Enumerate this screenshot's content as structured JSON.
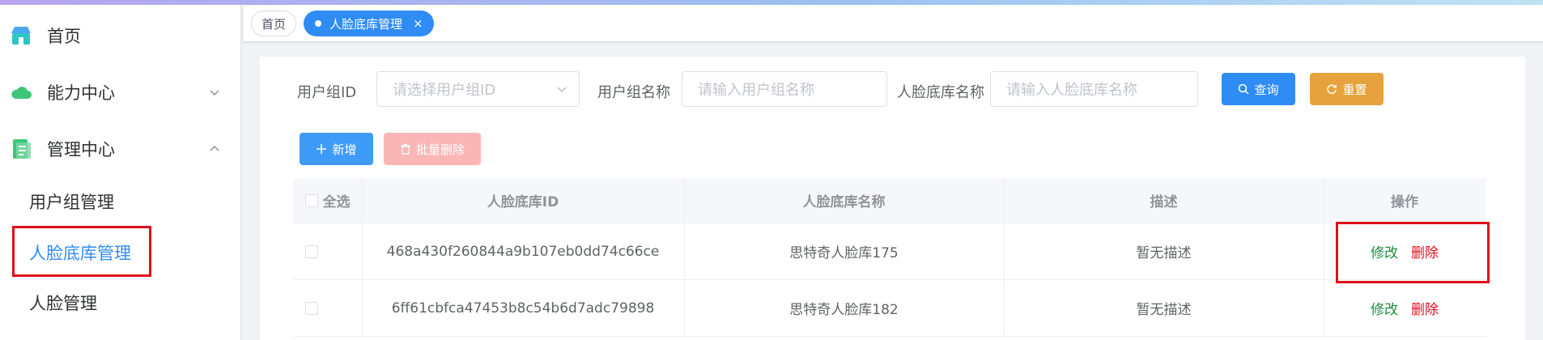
{
  "sidebar": {
    "items": [
      {
        "label": "首页",
        "icon": "store-icon"
      },
      {
        "label": "能力中心",
        "icon": "cloud-icon"
      },
      {
        "label": "管理中心",
        "icon": "document-icon"
      }
    ],
    "sub_items": [
      {
        "label": "用户组管理"
      },
      {
        "label": "人脸底库管理"
      },
      {
        "label": "人脸管理"
      }
    ]
  },
  "tabs": {
    "home": "首页",
    "active": "人脸底库管理",
    "close": "×"
  },
  "filters": {
    "group_id_label": "用户组ID",
    "group_id_placeholder": "请选择用户组ID",
    "group_name_label": "用户组名称",
    "group_name_placeholder": "请输入用户组名称",
    "lib_name_label": "人脸底库名称",
    "lib_name_placeholder": "请输入人脸底库名称",
    "search_label": "查询",
    "reset_label": "重置"
  },
  "actions": {
    "add_label": "新增",
    "batch_delete_label": "批量删除"
  },
  "table": {
    "headers": {
      "select_all": "全选",
      "id": "人脸底库ID",
      "name": "人脸底库名称",
      "desc": "描述",
      "ops": "操作"
    },
    "rows": [
      {
        "id": "468a430f260844a9b107eb0dd74c66ce",
        "name": "思特奇人脸库175",
        "desc": "暂无描述",
        "edit": "修改",
        "delete": "删除"
      },
      {
        "id": "6ff61cbfca47453b8c54b6d7adc79898",
        "name": "思特奇人脸库182",
        "desc": "暂无描述",
        "edit": "修改",
        "delete": "删除"
      }
    ]
  },
  "colors": {
    "primary": "#2f8cf5",
    "warning": "#e6a23c",
    "danger_light": "#fab6b6",
    "edit_link": "#1e8e3e",
    "delete_link": "#e0101a",
    "highlight": "#e0101a"
  }
}
